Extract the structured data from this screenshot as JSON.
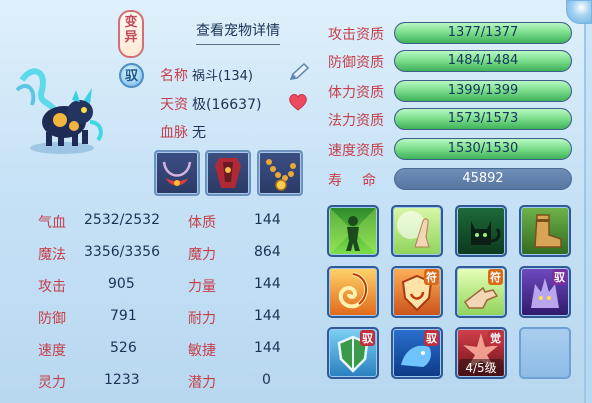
{
  "header": {
    "detail_link": "查看宠物详情"
  },
  "badges": {
    "variant_line1": "变",
    "variant_line2": "异",
    "tame": "驭"
  },
  "info": {
    "name_label": "名称",
    "name_value": "祸斗(134)",
    "aptitude_label": "天资",
    "aptitude_value": "极(16637)",
    "bloodline_label": "血脉",
    "bloodline_value": "无"
  },
  "icons": {
    "pen": "edit-pen-icon",
    "heart": "heart-icon",
    "equipment": [
      "necklace-icon",
      "armor-icon",
      "bead-necklace-icon"
    ]
  },
  "aptitudes": [
    {
      "label": "攻击资质",
      "value": "1377/1377",
      "fill": 1.0
    },
    {
      "label": "防御资质",
      "value": "1484/1484",
      "fill": 1.0
    },
    {
      "label": "体力资质",
      "value": "1399/1399",
      "fill": 1.0
    },
    {
      "label": "法力资质",
      "value": "1573/1573",
      "fill": 1.0
    },
    {
      "label": "速度资质",
      "value": "1530/1530",
      "fill": 1.0
    }
  ],
  "lifespan": {
    "label": "寿命",
    "value": "45892"
  },
  "stats": [
    {
      "label": "气血",
      "value": "2532/2532"
    },
    {
      "label": "体质",
      "value": "144"
    },
    {
      "label": "魔法",
      "value": "3356/3356"
    },
    {
      "label": "魔力",
      "value": "864"
    },
    {
      "label": "攻击",
      "value": "905"
    },
    {
      "label": "力量",
      "value": "144"
    },
    {
      "label": "防御",
      "value": "791"
    },
    {
      "label": "耐力",
      "value": "144"
    },
    {
      "label": "速度",
      "value": "526"
    },
    {
      "label": "敏捷",
      "value": "144"
    },
    {
      "label": "灵力",
      "value": "1233"
    },
    {
      "label": "潜力",
      "value": "0"
    }
  ],
  "skills": {
    "tags": {
      "fu": "符",
      "yu": "驭",
      "jue": "觉"
    },
    "level_text": "4/5级",
    "names": [
      "green-figure-skill-icon",
      "palm-light-skill-icon",
      "cat-skill-icon",
      "boot-skill-icon",
      "fire-swirl-skill-icon",
      "fire-shield-skill-icon",
      "pointing-hand-skill-icon",
      "wolf-skill-icon",
      "shield-skill-icon",
      "blue-beast-skill-icon",
      "red-burst-skill-icon",
      "empty-slot"
    ]
  },
  "colors": {
    "label_red": "#c53f4a",
    "text_navy": "#1b3456",
    "bar_green": "#7fe08f",
    "panel_blue": "#c7e2f6"
  }
}
